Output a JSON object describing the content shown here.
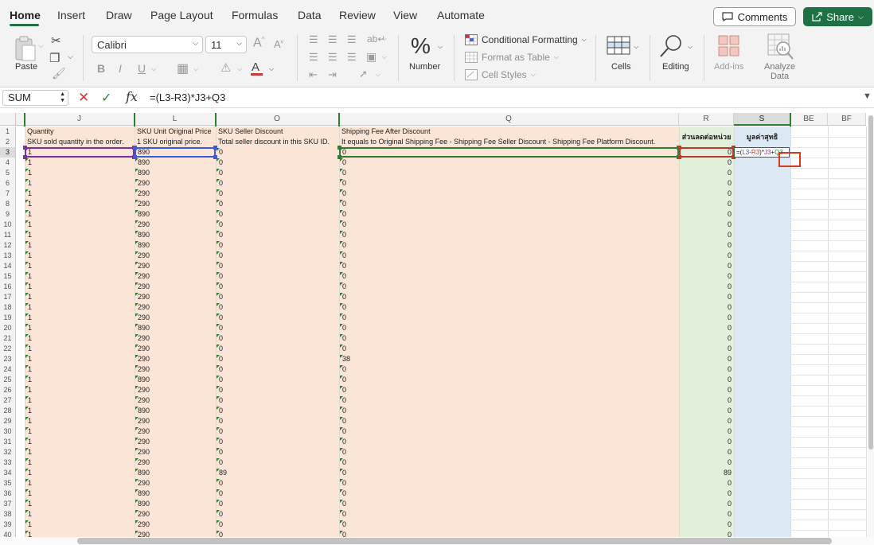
{
  "menu": {
    "tabs": [
      "Home",
      "Insert",
      "Draw",
      "Page Layout",
      "Formulas",
      "Data",
      "Review",
      "View",
      "Automate"
    ],
    "comments_label": "Comments",
    "share_label": "Share"
  },
  "ribbon": {
    "paste_label": "Paste",
    "font_name": "Calibri",
    "font_size": "11",
    "number_label": "Number",
    "conditional_formatting": "Conditional Formatting",
    "format_as_table": "Format as Table",
    "cell_styles": "Cell Styles",
    "cells_label": "Cells",
    "editing_label": "Editing",
    "addins_label": "Add-ins",
    "analyze_line1": "Analyze",
    "analyze_line2": "Data",
    "increase_font_glyph": "A",
    "bold_glyph": "B",
    "italic_glyph": "I",
    "underline_glyph": "U",
    "font_color_glyph": "A",
    "number_glyph": "%"
  },
  "formula_bar": {
    "name_box": "SUM",
    "fx_label": "fx",
    "formula": "=(L3-R3)*J3+Q3"
  },
  "columns": [
    {
      "id": "J",
      "header1": "Quantity",
      "header2": "SKU sold quantity in the order."
    },
    {
      "id": "L",
      "header1": "SKU Unit Original Price",
      "header2": "1 SKU original price."
    },
    {
      "id": "O",
      "header1": "SKU Seller Discount",
      "header2": "Total seller discount in this SKU ID."
    },
    {
      "id": "Q",
      "header1": "Shipping Fee After Discount",
      "header2": "It equals to Original Shipping Fee - Shipping Fee Seller Discount - Shipping Fee Platform Discount."
    },
    {
      "id": "R",
      "header1": "ส่วนลดต่อหน่วย",
      "header2": ""
    },
    {
      "id": "S",
      "header1": "มูลค่าสุทธิ",
      "header2": ""
    },
    {
      "id": "BE",
      "header1": "",
      "header2": ""
    },
    {
      "id": "BF",
      "header1": "",
      "header2": ""
    }
  ],
  "edit_cell": {
    "formula_parts": [
      "=(",
      "L3",
      "-",
      "R3",
      ")*",
      "J3",
      "+",
      "Q3"
    ],
    "ref_colors": [
      "#222222",
      "#3b5bdb",
      "#222222",
      "#c0392b",
      "#222222",
      "#7b2fa3",
      "#222222",
      "#2e7d32"
    ]
  },
  "rows": [
    {
      "n": "3",
      "J": "1",
      "L": "890",
      "O": "0",
      "Q": "0",
      "R": "0"
    },
    {
      "n": "4",
      "J": "1",
      "L": "890",
      "O": "0",
      "Q": "0",
      "R": "0"
    },
    {
      "n": "5",
      "J": "1",
      "L": "890",
      "O": "0",
      "Q": "0",
      "R": "0"
    },
    {
      "n": "6",
      "J": "1",
      "L": "290",
      "O": "0",
      "Q": "0",
      "R": "0"
    },
    {
      "n": "7",
      "J": "1",
      "L": "290",
      "O": "0",
      "Q": "0",
      "R": "0"
    },
    {
      "n": "8",
      "J": "1",
      "L": "290",
      "O": "0",
      "Q": "0",
      "R": "0"
    },
    {
      "n": "9",
      "J": "1",
      "L": "890",
      "O": "0",
      "Q": "0",
      "R": "0"
    },
    {
      "n": "10",
      "J": "1",
      "L": "290",
      "O": "0",
      "Q": "0",
      "R": "0"
    },
    {
      "n": "11",
      "J": "1",
      "L": "890",
      "O": "0",
      "Q": "0",
      "R": "0"
    },
    {
      "n": "12",
      "J": "1",
      "L": "890",
      "O": "0",
      "Q": "0",
      "R": "0"
    },
    {
      "n": "13",
      "J": "1",
      "L": "290",
      "O": "0",
      "Q": "0",
      "R": "0"
    },
    {
      "n": "14",
      "J": "1",
      "L": "290",
      "O": "0",
      "Q": "0",
      "R": "0"
    },
    {
      "n": "15",
      "J": "1",
      "L": "290",
      "O": "0",
      "Q": "0",
      "R": "0"
    },
    {
      "n": "16",
      "J": "1",
      "L": "290",
      "O": "0",
      "Q": "0",
      "R": "0"
    },
    {
      "n": "17",
      "J": "1",
      "L": "290",
      "O": "0",
      "Q": "0",
      "R": "0"
    },
    {
      "n": "18",
      "J": "1",
      "L": "290",
      "O": "0",
      "Q": "0",
      "R": "0"
    },
    {
      "n": "19",
      "J": "1",
      "L": "290",
      "O": "0",
      "Q": "0",
      "R": "0"
    },
    {
      "n": "20",
      "J": "1",
      "L": "890",
      "O": "0",
      "Q": "0",
      "R": "0"
    },
    {
      "n": "21",
      "J": "1",
      "L": "290",
      "O": "0",
      "Q": "0",
      "R": "0"
    },
    {
      "n": "22",
      "J": "1",
      "L": "290",
      "O": "0",
      "Q": "0",
      "R": "0"
    },
    {
      "n": "23",
      "J": "1",
      "L": "290",
      "O": "0",
      "Q": "38",
      "R": "0"
    },
    {
      "n": "24",
      "J": "1",
      "L": "290",
      "O": "0",
      "Q": "0",
      "R": "0"
    },
    {
      "n": "25",
      "J": "1",
      "L": "890",
      "O": "0",
      "Q": "0",
      "R": "0"
    },
    {
      "n": "26",
      "J": "1",
      "L": "290",
      "O": "0",
      "Q": "0",
      "R": "0"
    },
    {
      "n": "27",
      "J": "1",
      "L": "290",
      "O": "0",
      "Q": "0",
      "R": "0"
    },
    {
      "n": "28",
      "J": "1",
      "L": "890",
      "O": "0",
      "Q": "0",
      "R": "0"
    },
    {
      "n": "29",
      "J": "1",
      "L": "290",
      "O": "0",
      "Q": "0",
      "R": "0"
    },
    {
      "n": "30",
      "J": "1",
      "L": "290",
      "O": "0",
      "Q": "0",
      "R": "0"
    },
    {
      "n": "31",
      "J": "1",
      "L": "290",
      "O": "0",
      "Q": "0",
      "R": "0"
    },
    {
      "n": "32",
      "J": "1",
      "L": "290",
      "O": "0",
      "Q": "0",
      "R": "0"
    },
    {
      "n": "33",
      "J": "1",
      "L": "290",
      "O": "0",
      "Q": "0",
      "R": "0"
    },
    {
      "n": "34",
      "J": "1",
      "L": "890",
      "O": "89",
      "Q": "0",
      "R": "89"
    },
    {
      "n": "35",
      "J": "1",
      "L": "290",
      "O": "0",
      "Q": "0",
      "R": "0"
    },
    {
      "n": "36",
      "J": "1",
      "L": "890",
      "O": "0",
      "Q": "0",
      "R": "0"
    },
    {
      "n": "37",
      "J": "1",
      "L": "890",
      "O": "0",
      "Q": "0",
      "R": "0"
    },
    {
      "n": "38",
      "J": "1",
      "L": "290",
      "O": "0",
      "Q": "0",
      "R": "0"
    },
    {
      "n": "39",
      "J": "1",
      "L": "290",
      "O": "0",
      "Q": "0",
      "R": "0"
    },
    {
      "n": "40",
      "J": "1",
      "L": "290",
      "O": "0",
      "Q": "0",
      "R": "0"
    }
  ],
  "colors": {
    "accent": "#1e7145",
    "band_peach": "#fbe5d6",
    "band_green": "#e2efda",
    "band_blue": "#dde8f5",
    "ref_L": "#3b5bdb",
    "ref_R": "#c0392b",
    "ref_J": "#7b2fa3",
    "ref_Q": "#2e7d32",
    "highlight_box": "#d9381e"
  }
}
